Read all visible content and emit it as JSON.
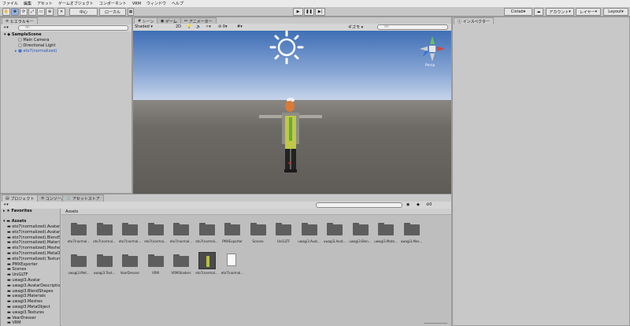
{
  "menu": [
    "ファイル",
    "編集",
    "アセット",
    "ゲームオブジェクト",
    "コンポーネント",
    "VRM",
    "ウィンドウ",
    "ヘルプ"
  ],
  "toolbar": {
    "pivot_label": "中心",
    "local_label": "ローカル",
    "account_label": "Cixtab",
    "account_menu_label": "アカウント",
    "layers_label": "レイヤー",
    "layout_label": "Layout"
  },
  "hierarchy": {
    "tab_label": "ヒエラルキー",
    "search_placeholder": "All",
    "scene": "SampleScene",
    "items": [
      "Main Camera",
      "Directional Light",
      "eto7(normalized)"
    ]
  },
  "scene_view": {
    "tabs": [
      "シーン",
      "ゲーム",
      "アニメーター"
    ],
    "shading_mode": "Shaded",
    "mode_2d": "2D",
    "gizmos_label": "ギズモ",
    "search_placeholder": "All",
    "persp_label": "Persp",
    "count_label": "0"
  },
  "inspector": {
    "tab_label": "インスペクター"
  },
  "project": {
    "tabs": [
      "プロジェクト",
      "コンソール",
      "アセットストア"
    ],
    "count_label": "0",
    "favorites_label": "Favorites",
    "assets_label": "Assets",
    "breadcrumb": "Assets",
    "tree_items": [
      "eto7(normalized).Avatar",
      "eto7(normalized).AvatarD",
      "eto7(normalized).BlendS",
      "eto7(normalized).Materia",
      "eto7(normalized).Meshes",
      "eto7(normalized).MetaOl",
      "eto7(normalized).Texture",
      "PMXExporter",
      "Scenes",
      "UniGLTF",
      "uwagi3.Avatar",
      "uwagi3.AvatarDescription",
      "uwagi3.BlendShapes",
      "uwagi3.Materials",
      "uwagi3.Meshes",
      "uwagi3.MetaObject",
      "uwagi3.Textures",
      "VearDresser",
      "VRM"
    ],
    "grid_row1": [
      "eto7(normal...",
      "eto7(normal...",
      "eto7(normal...",
      "eto7(normal...",
      "eto7(normal...",
      "eto7(normal...",
      "PMXExporter",
      "Scenes",
      "UniGLTF",
      "uwagi3.Avat...",
      "uwagi3.Avat...",
      "uwagi3.Blen...",
      "uwagi3.Mate...",
      "uwagi3.Mes..."
    ],
    "grid_row2": [
      "uwagi3.Met...",
      "uwagi3.Text...",
      "VearDresser",
      "VRM",
      "VRMShaders",
      "eto7(normal...",
      "eto7(normal..."
    ]
  },
  "colors": {
    "sky_top": "#3f6fb6",
    "sky_horizon": "#bfd0ea",
    "ground": "#6d6a66",
    "selection_blue": "#3a72d6"
  }
}
